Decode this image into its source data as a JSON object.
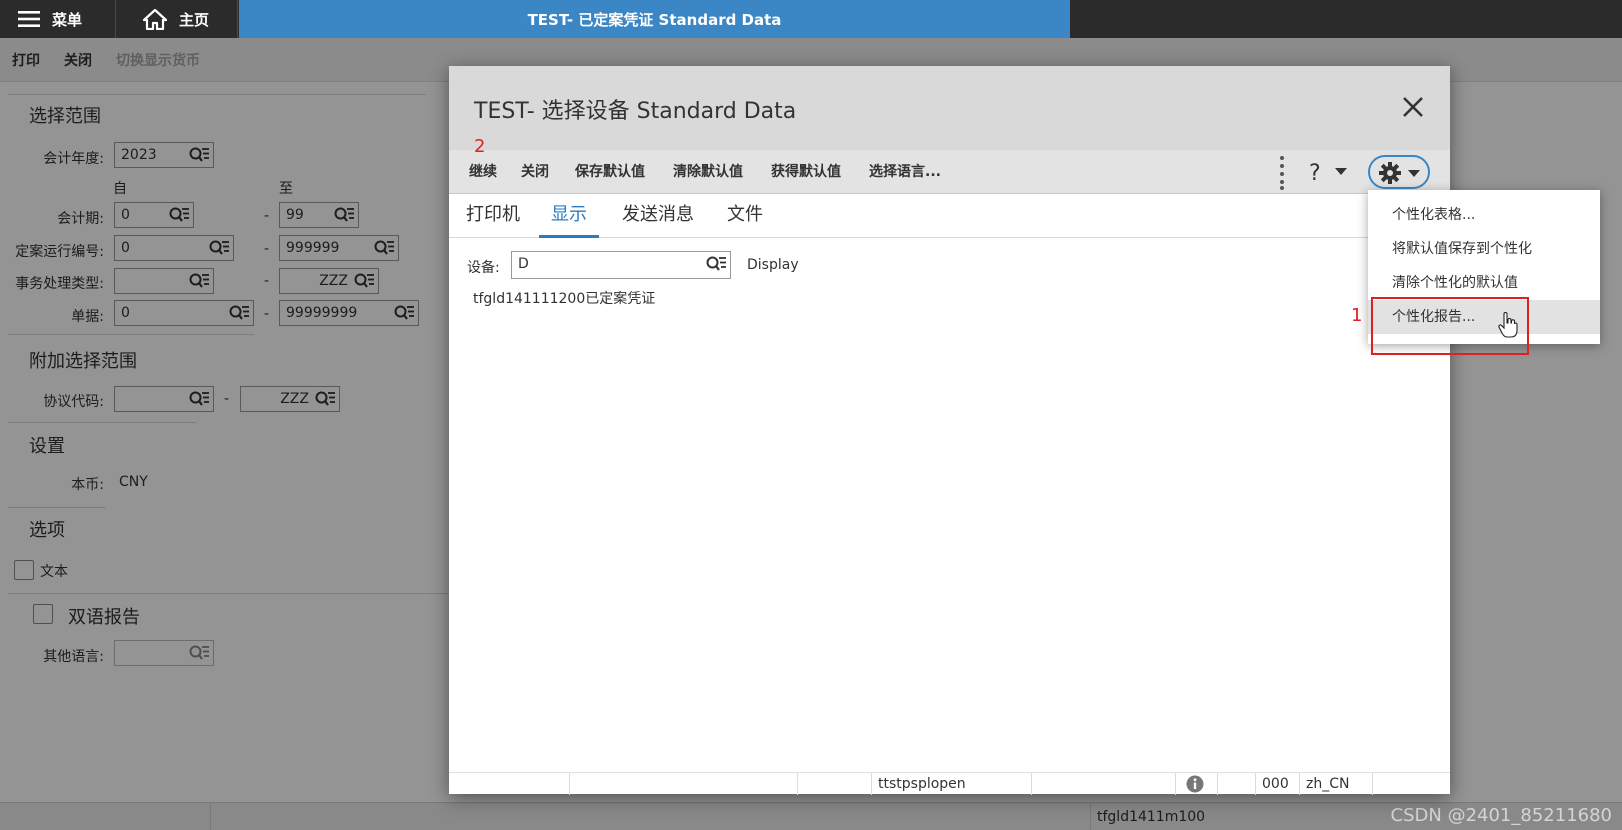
{
  "topbar": {
    "menu_label": "菜单",
    "home_label": "主页",
    "app_tab_title": "TEST- 已定案凭证 Standard Data"
  },
  "toolbar": {
    "print": "打印",
    "close": "关闭",
    "toggle_currency": "切换显示货币"
  },
  "form": {
    "selection_range_title": "选择范围",
    "fiscal_year_label": "会计年度:",
    "fiscal_year_value": "2023",
    "from_label": "自",
    "to_label": "至",
    "period_label": "会计期:",
    "period_from": "0",
    "period_to": "99",
    "run_no_label": "定案运行编号:",
    "run_no_from": "0",
    "run_no_to": "999999",
    "trans_type_label": "事务处理类型:",
    "trans_type_from": "",
    "trans_type_to": "ZZZ",
    "document_label": "单据:",
    "document_from": "0",
    "document_to": "99999999",
    "dash": "-",
    "additional_title": "附加选择范围",
    "agreement_label": "协议代码:",
    "agreement_from": "",
    "agreement_to": "ZZZ",
    "settings_title": "设置",
    "currency_label": "本币:",
    "currency_value": "CNY",
    "options_title": "选项",
    "text_checkbox_label": "文本",
    "bilingual_label": "双语报告",
    "other_lang_label": "其他语言:",
    "other_lang_value": ""
  },
  "modal": {
    "title": "TEST- 选择设备 Standard Data",
    "toolbar": {
      "continue": "继续",
      "close": "关闭",
      "save_default": "保存默认值",
      "clear_default": "清除默认值",
      "get_default": "获得默认值",
      "select_language": "选择语言..."
    },
    "annotation_2": "2",
    "annotation_1": "1",
    "tabs": [
      "打印机",
      "显示",
      "发送消息",
      "文件"
    ],
    "device_label": "设备:",
    "device_value": "D",
    "device_desc": "Display",
    "report_line": "tfgld141111200已定案凭证",
    "status": {
      "session": "ttstpsplopen",
      "code": "000",
      "locale": "zh_CN"
    }
  },
  "dropdown": {
    "items": [
      "个性化表格...",
      "将默认值保存到个性化",
      "清除个性化的默认值",
      "个性化报告..."
    ]
  },
  "statusbar": {
    "session": "tfgld1411m100"
  },
  "watermark": "CSDN @2401_85211680",
  "colors": {
    "accent": "#3b86c4",
    "annotation": "#e02020",
    "topbar": "#2b2b2b"
  }
}
